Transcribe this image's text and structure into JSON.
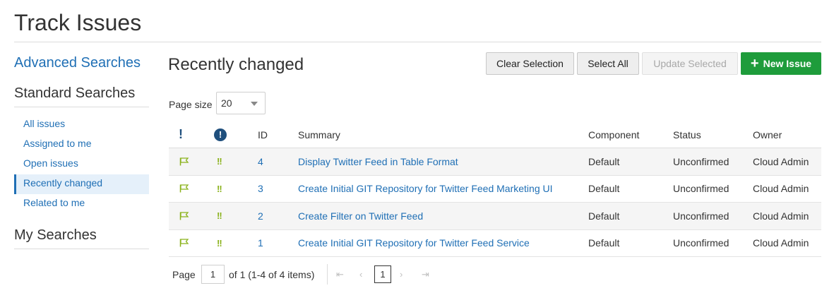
{
  "page": {
    "title": "Track Issues"
  },
  "sidebar": {
    "advanced": "Advanced Searches",
    "standard_heading": "Standard Searches",
    "items": [
      {
        "label": "All issues"
      },
      {
        "label": "Assigned to me"
      },
      {
        "label": "Open issues"
      },
      {
        "label": "Recently changed",
        "active": true
      },
      {
        "label": "Related to me"
      }
    ],
    "my_heading": "My Searches"
  },
  "main": {
    "title": "Recently changed",
    "buttons": {
      "clear": "Clear Selection",
      "select_all": "Select All",
      "update": "Update Selected",
      "new_issue": "New Issue"
    },
    "page_size_label": "Page size",
    "page_size_value": "20",
    "columns": [
      "ID",
      "Summary",
      "Component",
      "Status",
      "Owner"
    ],
    "rows": [
      {
        "id": "4",
        "summary": "Display Twitter Feed in Table Format",
        "component": "Default",
        "status": "Unconfirmed",
        "owner": "Cloud Admin"
      },
      {
        "id": "3",
        "summary": "Create Initial GIT Repository for Twitter Feed Marketing UI",
        "component": "Default",
        "status": "Unconfirmed",
        "owner": "Cloud Admin"
      },
      {
        "id": "2",
        "summary": "Create Filter on Twitter Feed",
        "component": "Default",
        "status": "Unconfirmed",
        "owner": "Cloud Admin"
      },
      {
        "id": "1",
        "summary": "Create Initial GIT Repository for Twitter Feed Service",
        "component": "Default",
        "status": "Unconfirmed",
        "owner": "Cloud Admin"
      }
    ],
    "pager": {
      "page_label": "Page",
      "page_value": "1",
      "of_text": "of 1 (1-4 of 4 items)",
      "current": "1"
    }
  },
  "icons": {
    "flag_color": "#8ab21b",
    "priority_color": "#8ab21b",
    "header_icon_color": "#1f4f7d",
    "accent": "#1f6fb5",
    "primary_button": "#1e9c3b"
  }
}
